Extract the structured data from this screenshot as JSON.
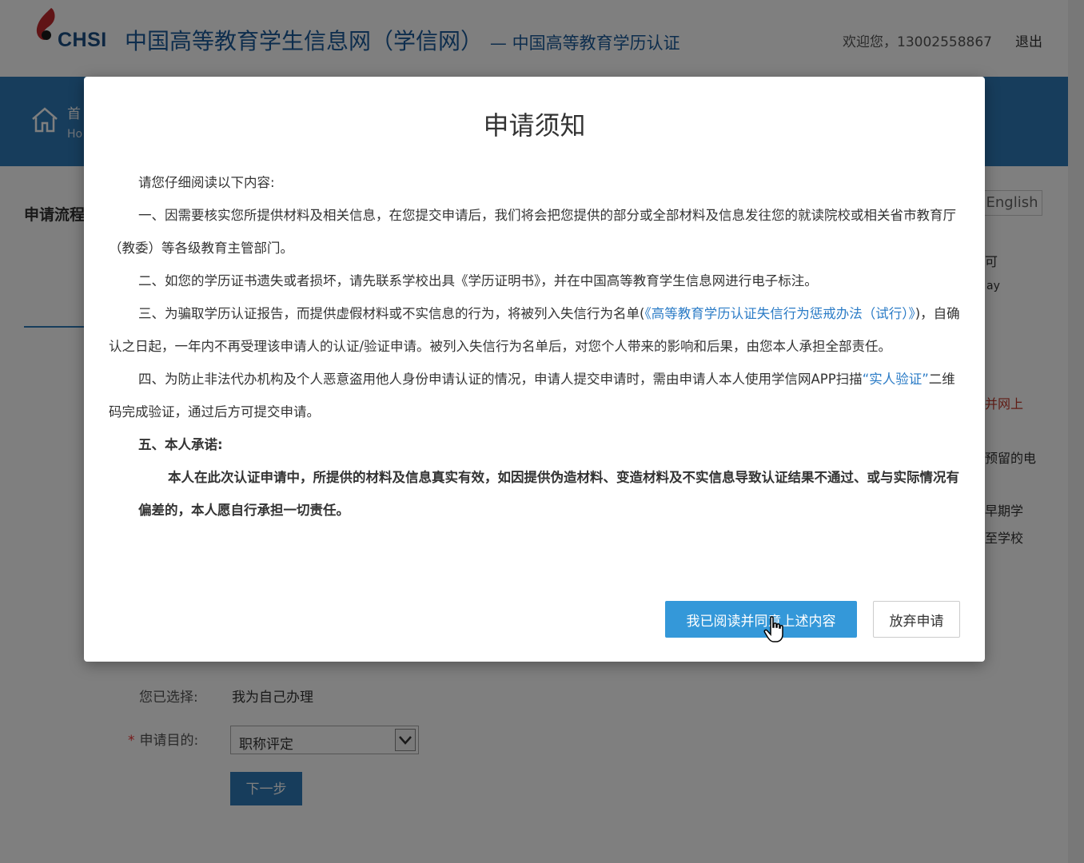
{
  "header": {
    "logo_text": "CHSI",
    "site_title": "中国高等教育学生信息网（学信网）",
    "site_subtitle": "— 中国高等教育学历认证",
    "welcome": "欢迎您，13002558867",
    "logout": "退出"
  },
  "nav": {
    "home_label": "首",
    "home_label_en": "Ho"
  },
  "sidebar": {
    "steps_label": "申请流程"
  },
  "right_panel": {
    "english_button": "English",
    "fragments": [
      "可",
      "ay",
      "并网上",
      "预留的电",
      "早期学",
      "至学校"
    ]
  },
  "form": {
    "chosen_label": "您已选择:",
    "chosen_value": "我为自己办理",
    "purpose_label": "申请目的:",
    "purpose_required": "*",
    "purpose_value": "职称评定",
    "next_button": "下一步"
  },
  "modal": {
    "title": "申请须知",
    "intro": "请您仔细阅读以下内容:",
    "item1": "一、因需要核实您所提供材料及相关信息，在您提交申请后，我们将会把您提供的部分或全部材料及信息发往您的就读院校或相关省市教育厅（教委）等各级教育主管部门。",
    "item2": "二、如您的学历证书遗失或者损坏，请先联系学校出具《学历证明书》，并在中国高等教育学生信息网进行电子标注。",
    "item3_a": "三、为骗取学历认证报告，而提供虚假材料或不实信息的行为，将被列入失信行为名单(",
    "item3_link": "《高等教育学历认证失信行为惩戒办法（试行）》",
    "item3_b": ")，自确认之日起，一年内不再受理该申请人的认证/验证申请。被列入失信行为名单后，对您个人带来的影响和后果，由您本人承担全部责任。",
    "item4_a": "四、为防止非法代办机构及个人恶意盗用他人身份申请认证的情况，申请人提交申请时，需由申请人本人使用学信网APP扫描",
    "item4_link": "“实人验证”",
    "item4_b": "二维码完成验证，通过后方可提交申请。",
    "item5_title": "五、本人承诺:",
    "item5_text": "本人在此次认证申请中，所提供的材料及信息真实有效，如因提供伪造材料、变造材料及不实信息导致认证结果不通过、或与实际情况有偏差的，本人愿自行承担一切责任。",
    "agree_button": "我已阅读并同意上述内容",
    "abandon_button": "放弃申请"
  },
  "colors": {
    "primary": "#3498d9",
    "nav": "#2e7ab8",
    "link": "#2a7bc6"
  }
}
